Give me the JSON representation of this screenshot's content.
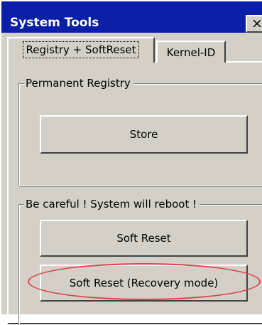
{
  "window": {
    "title": "System Tools",
    "close_label": "×"
  },
  "tabs": [
    {
      "label": "Registry + SoftReset",
      "active": true
    },
    {
      "label": "Kernel-ID",
      "active": false
    }
  ],
  "groups": {
    "permanent_registry": {
      "label": "Permanent Registry",
      "store_button": "Store"
    },
    "reboot": {
      "label": "Be careful ! System will reboot !",
      "soft_reset_button": "Soft Reset",
      "recovery_button": "Soft Reset (Recovery mode)"
    }
  },
  "colors": {
    "titlebar": "#0a1ea8",
    "face": "#d4d0c8",
    "highlight_ellipse": "#e0414b"
  }
}
